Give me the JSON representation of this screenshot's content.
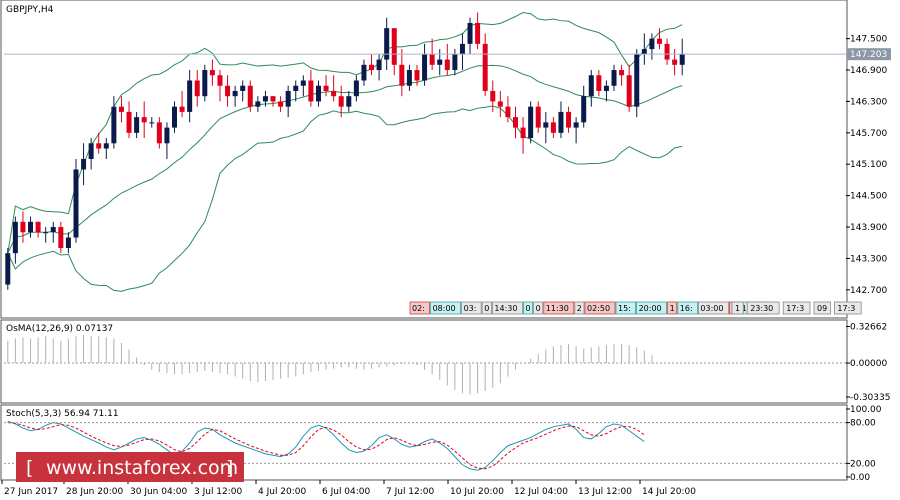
{
  "chart_data": [
    {
      "type": "candlestick",
      "title": "GBPJPY,H4",
      "ylim": [
        142.2,
        148.2
      ],
      "y_ticks": [
        "147.500",
        "146.900",
        "146.300",
        "145.700",
        "145.100",
        "144.500",
        "143.900",
        "143.300",
        "142.700"
      ],
      "current_price": "147.203",
      "overlays": [
        "Bollinger Bands"
      ],
      "colors": {
        "bull": "#0a1a4a",
        "bear": "#e0001b",
        "bands": "#2e8b57",
        "price_line": "#aab4c8",
        "badge": "#8c97a8"
      },
      "candles": [
        [
          142.8,
          143.5,
          142.7,
          143.4
        ],
        [
          143.4,
          144.1,
          143.2,
          144.0
        ],
        [
          144.0,
          144.2,
          143.6,
          143.8
        ],
        [
          143.8,
          144.1,
          143.7,
          144.0
        ],
        [
          144.0,
          144.0,
          143.7,
          143.8
        ],
        [
          143.8,
          143.9,
          143.6,
          143.8
        ],
        [
          143.8,
          144.0,
          143.6,
          143.9
        ],
        [
          143.9,
          144.0,
          143.4,
          143.5
        ],
        [
          143.5,
          143.8,
          143.4,
          143.7
        ],
        [
          143.7,
          145.2,
          143.6,
          145.0
        ],
        [
          145.0,
          145.5,
          144.7,
          145.2
        ],
        [
          145.2,
          145.6,
          145.0,
          145.5
        ],
        [
          145.5,
          145.7,
          145.3,
          145.4
        ],
        [
          145.4,
          145.6,
          145.2,
          145.5
        ],
        [
          145.5,
          146.4,
          145.4,
          146.2
        ],
        [
          146.2,
          146.4,
          145.9,
          146.1
        ],
        [
          146.1,
          146.3,
          145.6,
          145.7
        ],
        [
          145.7,
          146.1,
          145.6,
          146.0
        ],
        [
          146.0,
          146.3,
          145.6,
          145.9
        ],
        [
          145.9,
          146.0,
          145.8,
          145.9
        ],
        [
          145.9,
          146.0,
          145.4,
          145.5
        ],
        [
          145.5,
          145.9,
          145.2,
          145.8
        ],
        [
          145.8,
          146.3,
          145.7,
          146.2
        ],
        [
          146.2,
          146.5,
          146.0,
          146.1
        ],
        [
          146.1,
          146.9,
          145.9,
          146.7
        ],
        [
          146.7,
          146.9,
          146.2,
          146.4
        ],
        [
          146.4,
          147.0,
          146.3,
          146.9
        ],
        [
          146.9,
          147.1,
          146.6,
          146.8
        ],
        [
          146.8,
          146.9,
          146.3,
          146.6
        ],
        [
          146.6,
          146.8,
          146.2,
          146.4
        ],
        [
          146.4,
          146.6,
          146.2,
          146.5
        ],
        [
          146.5,
          146.7,
          146.3,
          146.6
        ],
        [
          146.6,
          146.7,
          146.1,
          146.2
        ],
        [
          146.2,
          146.4,
          146.1,
          146.3
        ],
        [
          146.3,
          146.5,
          146.2,
          146.4
        ],
        [
          146.4,
          146.4,
          146.2,
          146.3
        ],
        [
          146.3,
          146.4,
          146.1,
          146.2
        ],
        [
          146.2,
          146.6,
          146.0,
          146.5
        ],
        [
          146.5,
          146.7,
          146.3,
          146.6
        ],
        [
          146.6,
          146.8,
          146.4,
          146.7
        ],
        [
          146.7,
          146.9,
          146.2,
          146.3
        ],
        [
          146.3,
          146.7,
          146.2,
          146.6
        ],
        [
          146.6,
          146.8,
          146.4,
          146.5
        ],
        [
          146.5,
          146.8,
          146.3,
          146.4
        ],
        [
          146.4,
          146.6,
          146.0,
          146.2
        ],
        [
          146.2,
          146.5,
          146.1,
          146.4
        ],
        [
          146.4,
          146.8,
          146.3,
          146.7
        ],
        [
          146.7,
          147.1,
          146.6,
          147.0
        ],
        [
          147.0,
          147.2,
          146.8,
          146.9
        ],
        [
          146.9,
          147.2,
          146.7,
          147.1
        ],
        [
          147.1,
          147.9,
          146.9,
          147.7
        ],
        [
          147.7,
          147.7,
          146.8,
          147.0
        ],
        [
          147.0,
          147.3,
          146.4,
          146.6
        ],
        [
          146.6,
          147.0,
          146.5,
          146.9
        ],
        [
          146.9,
          147.0,
          146.6,
          146.7
        ],
        [
          146.7,
          147.4,
          146.6,
          147.2
        ],
        [
          147.2,
          147.5,
          146.9,
          147.0
        ],
        [
          147.0,
          147.3,
          146.8,
          147.1
        ],
        [
          147.1,
          147.4,
          146.8,
          146.9
        ],
        [
          146.9,
          147.3,
          146.8,
          147.2
        ],
        [
          147.2,
          147.6,
          146.9,
          147.4
        ],
        [
          147.4,
          147.9,
          147.2,
          147.8
        ],
        [
          147.8,
          148.0,
          147.3,
          147.4
        ],
        [
          147.4,
          147.6,
          146.4,
          146.5
        ],
        [
          146.5,
          146.7,
          146.1,
          146.3
        ],
        [
          146.3,
          146.5,
          146.0,
          146.2
        ],
        [
          146.2,
          146.4,
          145.9,
          146.0
        ],
        [
          146.0,
          146.2,
          145.6,
          145.8
        ],
        [
          145.8,
          146.0,
          145.3,
          145.6
        ],
        [
          145.6,
          146.3,
          145.5,
          146.2
        ],
        [
          146.2,
          146.3,
          145.7,
          145.8
        ],
        [
          145.8,
          146.1,
          145.5,
          145.9
        ],
        [
          145.9,
          146.0,
          145.6,
          145.7
        ],
        [
          145.7,
          146.3,
          145.6,
          146.1
        ],
        [
          146.1,
          146.2,
          145.7,
          145.8
        ],
        [
          145.8,
          146.0,
          145.5,
          145.9
        ],
        [
          145.9,
          146.6,
          145.8,
          146.4
        ],
        [
          146.4,
          146.9,
          146.2,
          146.8
        ],
        [
          146.8,
          146.9,
          146.4,
          146.5
        ],
        [
          146.5,
          146.7,
          146.3,
          146.6
        ],
        [
          146.6,
          147.0,
          146.5,
          146.9
        ],
        [
          146.9,
          147.0,
          146.6,
          146.8
        ],
        [
          146.8,
          147.0,
          146.1,
          146.2
        ],
        [
          146.2,
          147.3,
          146.0,
          147.2
        ],
        [
          147.2,
          147.6,
          147.0,
          147.3
        ],
        [
          147.3,
          147.6,
          147.1,
          147.5
        ],
        [
          147.5,
          147.7,
          147.3,
          147.4
        ],
        [
          147.4,
          147.5,
          147.0,
          147.1
        ],
        [
          147.1,
          147.3,
          146.8,
          147.0
        ],
        [
          147.0,
          147.5,
          146.8,
          147.2
        ]
      ],
      "markers": [
        {
          "label": "02:",
          "color": "red"
        },
        {
          "label": "08:00",
          "color": "teal"
        },
        {
          "label": "03:",
          "color": "grey"
        },
        {
          "label": "0",
          "color": "grey"
        },
        {
          "label": "14:30",
          "color": "grey"
        },
        {
          "label": "0",
          "color": "teal"
        },
        {
          "label": "0",
          "color": "grey"
        },
        {
          "label": "11:30",
          "color": "red"
        },
        {
          "label": "2",
          "color": "grey"
        },
        {
          "label": "02:50",
          "color": "red"
        },
        {
          "label": "15:",
          "color": "teal"
        },
        {
          "label": "20:00",
          "color": "teal"
        },
        {
          "label": "1",
          "color": "red"
        },
        {
          "label": "16:",
          "color": "teal"
        },
        {
          "label": "03:00",
          "color": "grey"
        },
        {
          "label": "1",
          "color": "red"
        },
        {
          "label": "18:30",
          "color": "teal"
        }
      ],
      "markers_right": [
        {
          "label": "1",
          "color": "grey"
        },
        {
          "label": "23:30",
          "color": "grey"
        },
        {
          "label": "17:3",
          "color": "grey"
        },
        {
          "label": "09",
          "color": "grey"
        },
        {
          "label": "17:3",
          "color": "grey"
        }
      ]
    },
    {
      "type": "bar",
      "title": "OsMA(12,26,9) 0.07137",
      "ylim": [
        -0.33,
        0.34
      ],
      "y_ticks": [
        "0.32662",
        "0.00000",
        "-0.30335"
      ],
      "color": "#b0b0b0",
      "values": [
        0.2,
        0.22,
        0.23,
        0.22,
        0.23,
        0.24,
        0.22,
        0.2,
        0.22,
        0.24,
        0.25,
        0.24,
        0.24,
        0.23,
        0.22,
        0.18,
        0.12,
        0.05,
        -0.02,
        -0.06,
        -0.08,
        -0.09,
        -0.1,
        -0.1,
        -0.09,
        -0.08,
        -0.07,
        -0.08,
        -0.09,
        -0.1,
        -0.12,
        -0.14,
        -0.16,
        -0.17,
        -0.16,
        -0.15,
        -0.14,
        -0.13,
        -0.12,
        -0.1,
        -0.08,
        -0.07,
        -0.06,
        -0.05,
        -0.04,
        -0.04,
        -0.05,
        -0.06,
        -0.05,
        -0.04,
        -0.03,
        -0.02,
        -0.01,
        0.0,
        -0.02,
        -0.06,
        -0.1,
        -0.15,
        -0.2,
        -0.24,
        -0.27,
        -0.28,
        -0.27,
        -0.25,
        -0.22,
        -0.18,
        -0.12,
        -0.06,
        0.0,
        0.04,
        0.08,
        0.12,
        0.15,
        0.16,
        0.17,
        0.15,
        0.13,
        0.14,
        0.15,
        0.16,
        0.17,
        0.17,
        0.16,
        0.14,
        0.11,
        0.07
      ]
    },
    {
      "type": "line",
      "title": "Stoch(5,3,3) 56.94 71.11",
      "ylim": [
        0,
        100
      ],
      "y_ticks": [
        "100.00",
        "80.00",
        "20.00",
        "0.00"
      ],
      "levels": [
        80,
        20
      ],
      "series": [
        {
          "color": "#1a9ab0",
          "values": [
            82,
            78,
            72,
            68,
            70,
            76,
            80,
            78,
            72,
            66,
            60,
            55,
            50,
            44,
            40,
            44,
            50,
            56,
            58,
            54,
            48,
            40,
            32,
            38,
            50,
            66,
            72,
            70,
            62,
            56,
            50,
            46,
            42,
            38,
            34,
            32,
            30,
            34,
            44,
            60,
            72,
            76,
            72,
            62,
            50,
            40,
            36,
            38,
            46,
            58,
            62,
            56,
            48,
            44,
            46,
            52,
            56,
            50,
            42,
            30,
            18,
            12,
            10,
            14,
            24,
            36,
            46,
            50,
            54,
            58,
            64,
            70,
            74,
            76,
            78,
            70,
            58,
            56,
            64,
            74,
            78,
            76,
            68,
            60,
            52
          ]
        },
        {
          "color": "#e0001b",
          "values": [
            80,
            79,
            76,
            72,
            70,
            71,
            74,
            77,
            76,
            72,
            66,
            60,
            55,
            50,
            46,
            45,
            47,
            51,
            55,
            56,
            53,
            47,
            40,
            37,
            42,
            52,
            63,
            70,
            68,
            62,
            56,
            51,
            46,
            42,
            38,
            35,
            32,
            32,
            36,
            46,
            59,
            70,
            73,
            69,
            62,
            52,
            44,
            40,
            41,
            47,
            55,
            58,
            54,
            49,
            46,
            48,
            51,
            52,
            47,
            38,
            28,
            18,
            13,
            12,
            16,
            25,
            35,
            43,
            50,
            54,
            58,
            63,
            68,
            72,
            75,
            74,
            68,
            62,
            60,
            64,
            70,
            74,
            74,
            70,
            62
          ]
        }
      ]
    }
  ],
  "x_axis_labels": [
    "27 Jun 2017",
    "28 Jun 20:00",
    "30 Jun 04:00",
    "3 Jul 12:00",
    "4 Jul 20:00",
    "6 Jul 04:00",
    "7 Jul 12:00",
    "10 Jul 20:00",
    "12 Jul 04:00",
    "13 Jul 12:00",
    "14 Jul 20:00"
  ],
  "watermark": "www.instaforex.com",
  "watermark_prefix": "[",
  "watermark_suffix": "]",
  "watermark_color": "#c8323c"
}
